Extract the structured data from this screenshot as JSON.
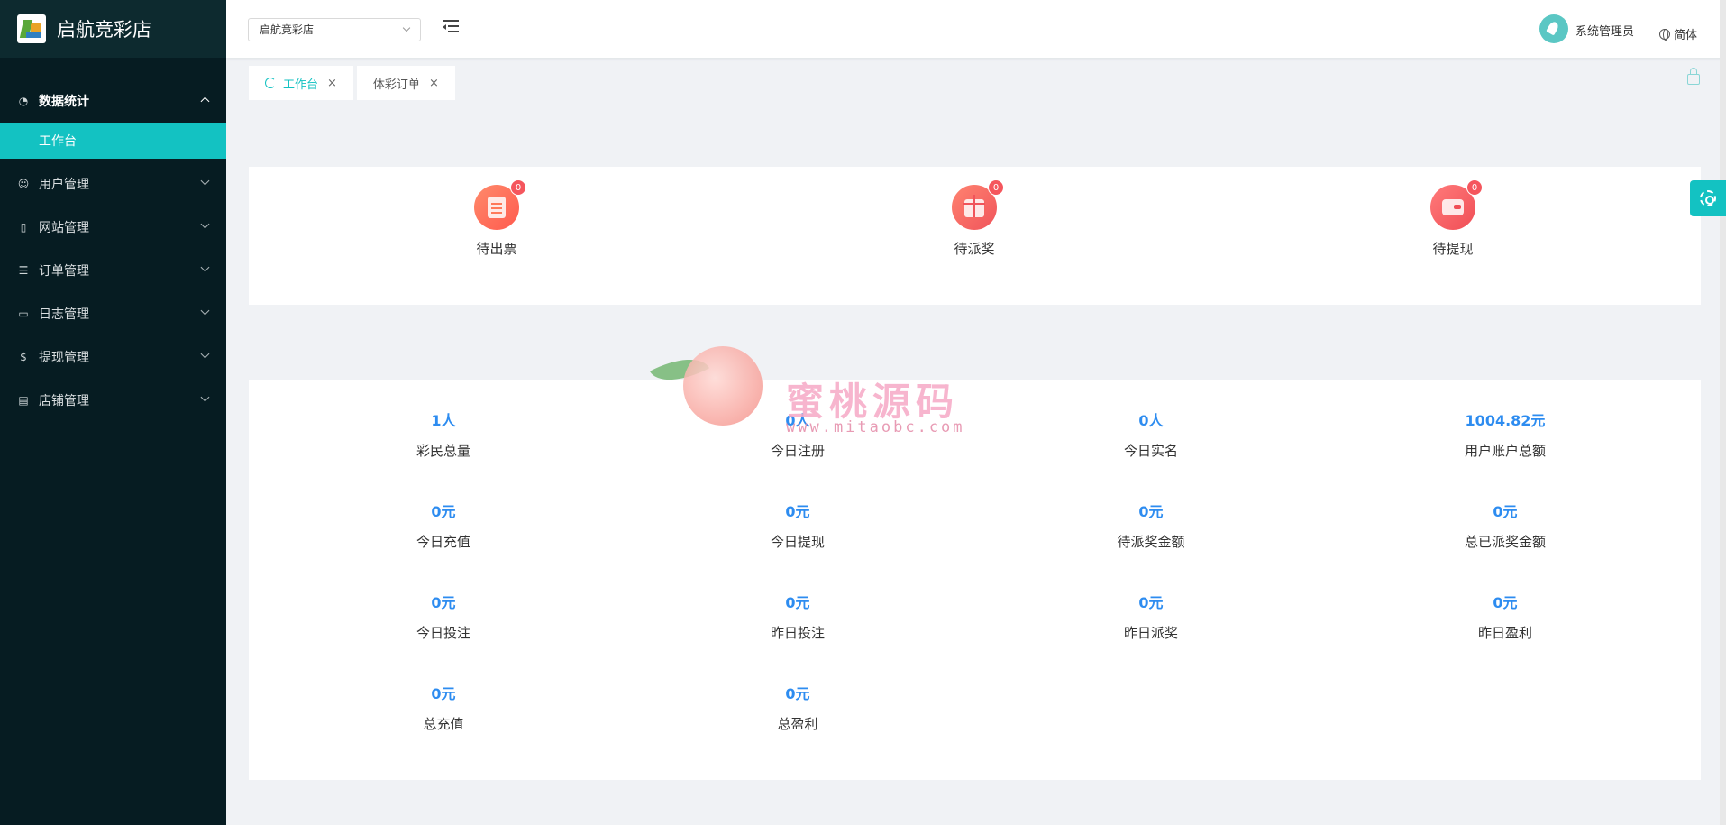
{
  "app": {
    "title": "启航竞彩店"
  },
  "sidebar": {
    "items": [
      {
        "label": "数据统计",
        "icon": "dashboard-icon",
        "open": true
      },
      {
        "label": "用户管理",
        "icon": "user-icon"
      },
      {
        "label": "网站管理",
        "icon": "file-icon"
      },
      {
        "label": "订单管理",
        "icon": "list-icon"
      },
      {
        "label": "日志管理",
        "icon": "book-icon"
      },
      {
        "label": "提现管理",
        "icon": "money-icon"
      },
      {
        "label": "店铺管理",
        "icon": "shop-icon"
      }
    ],
    "active_sub": "工作台"
  },
  "header": {
    "store_select": "启航竞彩店",
    "user_name": "系统管理员",
    "language": "简体"
  },
  "tabs": [
    {
      "label": "工作台",
      "active": true
    },
    {
      "label": "体彩订单",
      "active": false
    }
  ],
  "todos": [
    {
      "label": "待出票",
      "count": "0",
      "icon": "clipboard-icon"
    },
    {
      "label": "待派奖",
      "count": "0",
      "icon": "gift-icon"
    },
    {
      "label": "待提现",
      "count": "0",
      "icon": "wallet-icon"
    }
  ],
  "stats": [
    {
      "value": "1人",
      "label": "彩民总量"
    },
    {
      "value": "0人",
      "label": "今日注册"
    },
    {
      "value": "0人",
      "label": "今日实名"
    },
    {
      "value": "1004.82元",
      "label": "用户账户总额"
    },
    {
      "value": "0元",
      "label": "今日充值"
    },
    {
      "value": "0元",
      "label": "今日提现"
    },
    {
      "value": "0元",
      "label": "待派奖金额"
    },
    {
      "value": "0元",
      "label": "总已派奖金额"
    },
    {
      "value": "0元",
      "label": "今日投注"
    },
    {
      "value": "0元",
      "label": "昨日投注"
    },
    {
      "value": "0元",
      "label": "昨日派奖"
    },
    {
      "value": "0元",
      "label": "昨日盈利"
    },
    {
      "value": "0元",
      "label": "总充值"
    },
    {
      "value": "0元",
      "label": "总盈利"
    }
  ],
  "watermark": {
    "title": "蜜桃源码",
    "url": "www.mitaobc.com"
  },
  "colors": {
    "accent": "#13c2c2",
    "sidebar_bg": "#061c22",
    "stat_value": "#2d8cf0",
    "badge": "#f5565d"
  }
}
